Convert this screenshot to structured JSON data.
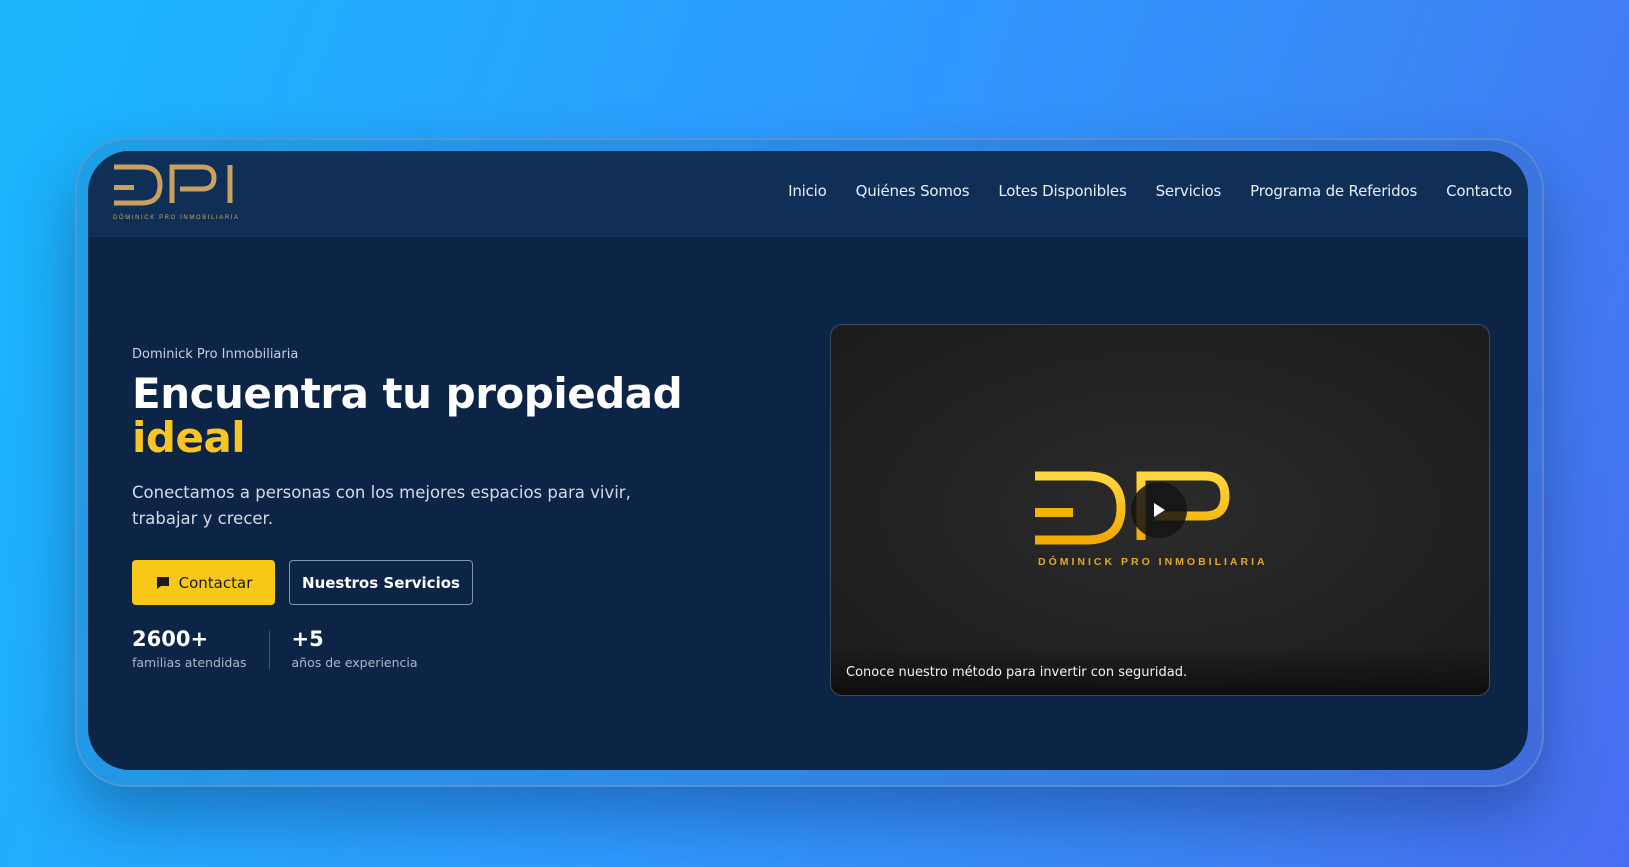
{
  "brand": {
    "logo_text": "DPI",
    "tagline": "DÓMINICK PRO INMOBILIARIA",
    "gold": "#caa061",
    "yellow": "#f7c624"
  },
  "nav": {
    "items": [
      {
        "label": "Inicio"
      },
      {
        "label": "Quiénes Somos"
      },
      {
        "label": "Lotes Disponibles"
      },
      {
        "label": "Servicios"
      },
      {
        "label": "Programa de Referidos"
      },
      {
        "label": "Contacto"
      }
    ]
  },
  "hero": {
    "eyebrow": "Dominick Pro Inmobiliaria",
    "title_line1": "Encuentra tu propiedad",
    "title_accent": "ideal",
    "lead": "Conectamos a personas con los mejores espacios para vivir, trabajar y crecer.",
    "primary_button": {
      "label": "Contactar",
      "icon": "chat-icon"
    },
    "secondary_button": {
      "label": "Nuestros Servicios"
    },
    "stats": [
      {
        "value": "2600+",
        "label": "familias atendidas"
      },
      {
        "value": "+5",
        "label": "años de experiencia"
      }
    ]
  },
  "video": {
    "logo_text": "DPI",
    "tagline": "DÓMINICK PRO INMOBILIARIA",
    "play_icon": "play-icon",
    "caption": "Conoce nuestro método para invertir con seguridad."
  }
}
